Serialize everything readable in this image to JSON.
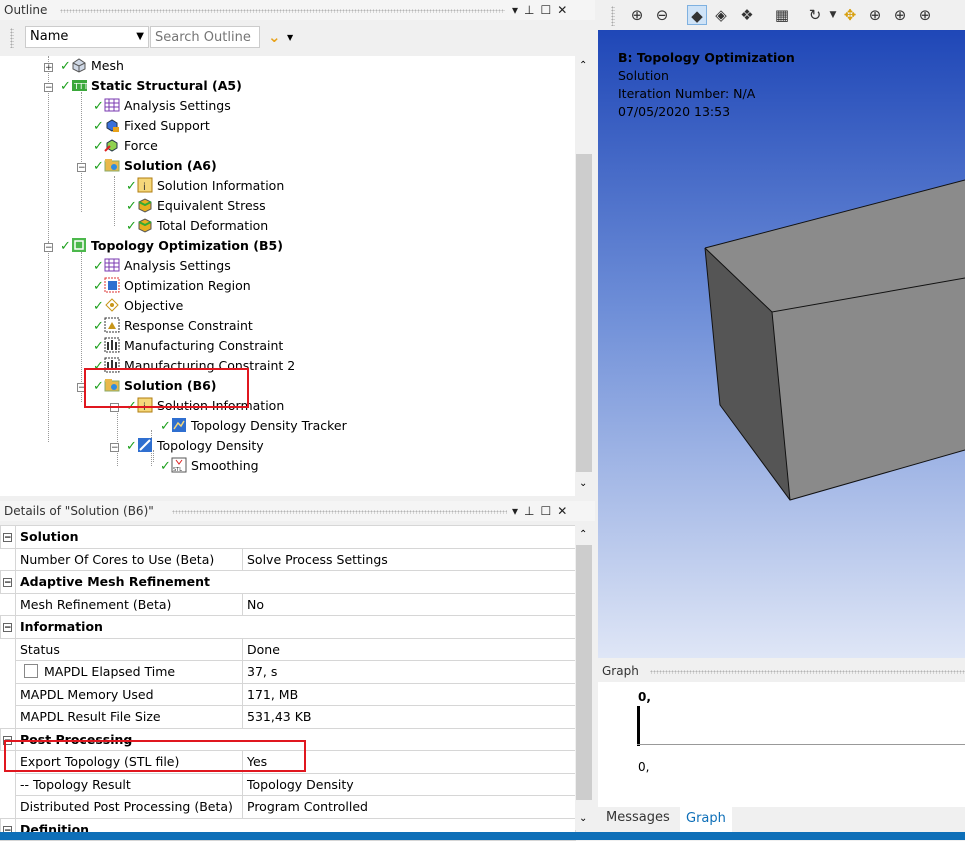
{
  "outline": {
    "title": "Outline",
    "filter_label": "Name",
    "search_placeholder": "Search Outline",
    "nodes": [
      {
        "label": "Mesh"
      },
      {
        "label": "Static Structural (A5)"
      },
      {
        "label": "Analysis Settings"
      },
      {
        "label": "Fixed Support"
      },
      {
        "label": "Force"
      },
      {
        "label": "Solution (A6)"
      },
      {
        "label": "Solution Information"
      },
      {
        "label": "Equivalent Stress"
      },
      {
        "label": "Total Deformation"
      },
      {
        "label": "Topology Optimization (B5)"
      },
      {
        "label": "Analysis Settings"
      },
      {
        "label": "Optimization Region"
      },
      {
        "label": "Objective"
      },
      {
        "label": "Response Constraint"
      },
      {
        "label": "Manufacturing Constraint"
      },
      {
        "label": "Manufacturing Constraint 2"
      },
      {
        "label": "Solution (B6)"
      },
      {
        "label": "Solution Information"
      },
      {
        "label": "Topology Density Tracker"
      },
      {
        "label": "Topology Density"
      },
      {
        "label": "Smoothing"
      }
    ]
  },
  "details": {
    "title": "Details of \"Solution (B6)\"",
    "groups": [
      {
        "name": "Solution",
        "rows": [
          [
            "Number Of Cores to Use (Beta)",
            "Solve Process Settings"
          ]
        ]
      },
      {
        "name": "Adaptive Mesh Refinement",
        "rows": [
          [
            "Mesh Refinement (Beta)",
            "No"
          ]
        ]
      },
      {
        "name": "Information",
        "rows": [
          [
            "Status",
            "Done"
          ],
          [
            "MAPDL Elapsed Time",
            "37, s"
          ],
          [
            "MAPDL Memory Used",
            "171, MB"
          ],
          [
            "MAPDL Result File Size",
            "531,43 KB"
          ]
        ]
      },
      {
        "name": "Post Processing",
        "rows": [
          [
            "Export Topology (STL file)",
            "Yes"
          ],
          [
            "-- Topology Result",
            "Topology Density"
          ],
          [
            "Distributed Post Processing (Beta)",
            "Program Controlled"
          ]
        ]
      },
      {
        "name": "Definition",
        "rows": []
      }
    ]
  },
  "viewport": {
    "title": "B: Topology Optimization",
    "line1": "Solution",
    "line2": "Iteration Number: N/A",
    "line3": "07/05/2020 13:53"
  },
  "graph": {
    "title": "Graph",
    "y_top": "0,",
    "y_bottom": "0,",
    "tabs": [
      "Messages",
      "Graph"
    ]
  },
  "colors": {
    "check": "#1ea01e",
    "highlight": "#e0171f",
    "viewport_top": "#1f47b7"
  }
}
